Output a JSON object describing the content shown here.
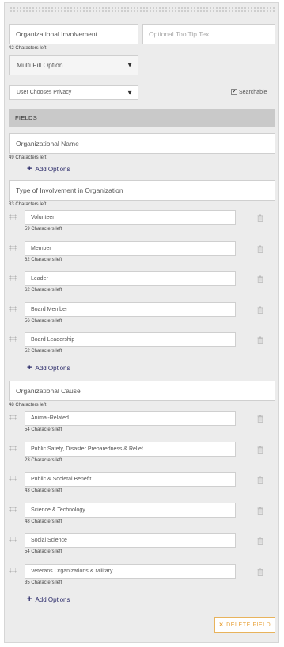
{
  "top": {
    "name_value": "Organizational Involvement",
    "name_hint": "42 Characters left",
    "tooltip_placeholder": "Optional ToolTip Text",
    "fill_option": "Multi Fill Option",
    "privacy_option": "User Chooses Privacy",
    "searchable_label": "Searchable",
    "searchable_checked": true
  },
  "fields_header": "FIELDS",
  "add_options_label": "Add Options",
  "fields": [
    {
      "label": "Organizational Name",
      "hint": "49 Characters left",
      "options": []
    },
    {
      "label": "Type of Involvement in Organization",
      "hint": "33 Characters left",
      "options": [
        {
          "value": "Volunteer",
          "hint": "59 Characters left"
        },
        {
          "value": "Member",
          "hint": "62 Characters left"
        },
        {
          "value": "Leader",
          "hint": "62 Characters left"
        },
        {
          "value": "Board Member",
          "hint": "56 Characters left"
        },
        {
          "value": "Board Leadership",
          "hint": "52 Characters left"
        }
      ]
    },
    {
      "label": "Organizational Cause",
      "hint": "48 Characters left",
      "options": [
        {
          "value": "Animal-Related",
          "hint": "54 Characters left"
        },
        {
          "value": "Public Safety, Disaster Preparedness & Relief",
          "hint": "23 Characters left"
        },
        {
          "value": "Public & Societal Benefit",
          "hint": "43 Characters left"
        },
        {
          "value": "Science & Technology",
          "hint": "48 Characters left"
        },
        {
          "value": "Social Science",
          "hint": "54 Characters left"
        },
        {
          "value": "Veterans Organizations & Military",
          "hint": "35 Characters left"
        }
      ]
    }
  ],
  "delete_label": "DELETE FIELD",
  "colors": {
    "accent": "#2b2b6a",
    "delete": "#e8a33c",
    "header_bg": "#c9c9c9",
    "panel_bg": "#ececec"
  },
  "icons": {
    "add": "plus-icon",
    "delete_option": "trash-icon",
    "drag": "drag-handle-icon",
    "delete_field": "x-icon"
  }
}
